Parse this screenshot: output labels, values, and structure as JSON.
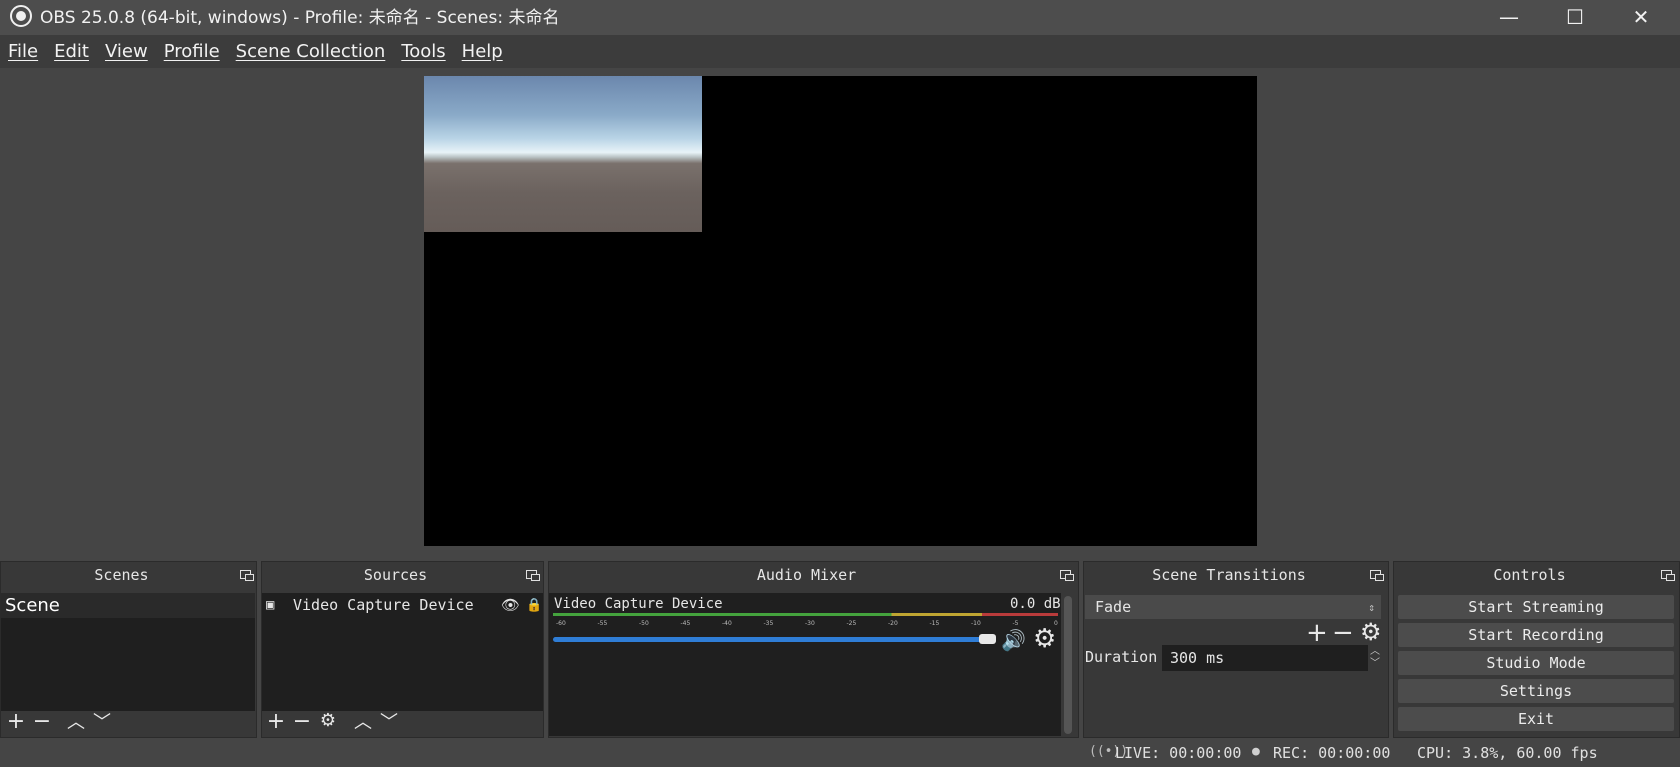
{
  "window": {
    "title": "OBS 25.0.8 (64-bit, windows) - Profile: 未命名 - Scenes: 未命名",
    "minimize": "—",
    "maximize": "☐",
    "close": "✕"
  },
  "menu": {
    "file": "File",
    "edit": "Edit",
    "view": "View",
    "profile": "Profile",
    "scene_collection": "Scene Collection",
    "tools": "Tools",
    "help": "Help"
  },
  "docks": {
    "scenes": {
      "title": "Scenes",
      "items": [
        "Scene"
      ]
    },
    "sources": {
      "title": "Sources",
      "items": [
        {
          "label": "Video Capture Device",
          "icon": "camera-icon"
        }
      ]
    },
    "mixer": {
      "title": "Audio Mixer",
      "channel": "Video Capture Device",
      "db": "0.0 dB",
      "ticks": [
        "-60",
        "-55",
        "-50",
        "-45",
        "-40",
        "-35",
        "-30",
        "-25",
        "-20",
        "-15",
        "-10",
        "-5",
        "0"
      ],
      "volume_fraction": 1.0,
      "colors": {
        "green": "#44a33d",
        "yellow": "#bfa532",
        "red": "#b93b3b",
        "slider": "#2f7dd6"
      }
    },
    "transitions": {
      "title": "Scene Transitions",
      "selected": "Fade",
      "duration_label": "Duration",
      "duration_value": "300 ms"
    },
    "controls": {
      "title": "Controls",
      "start_streaming": "Start Streaming",
      "start_recording": "Start Recording",
      "studio_mode": "Studio Mode",
      "settings": "Settings",
      "exit": "Exit"
    }
  },
  "status": {
    "live": "LIVE: 00:00:00",
    "rec": "REC: 00:00:00",
    "cpu": "CPU: 3.8%, 60.00 fps"
  }
}
